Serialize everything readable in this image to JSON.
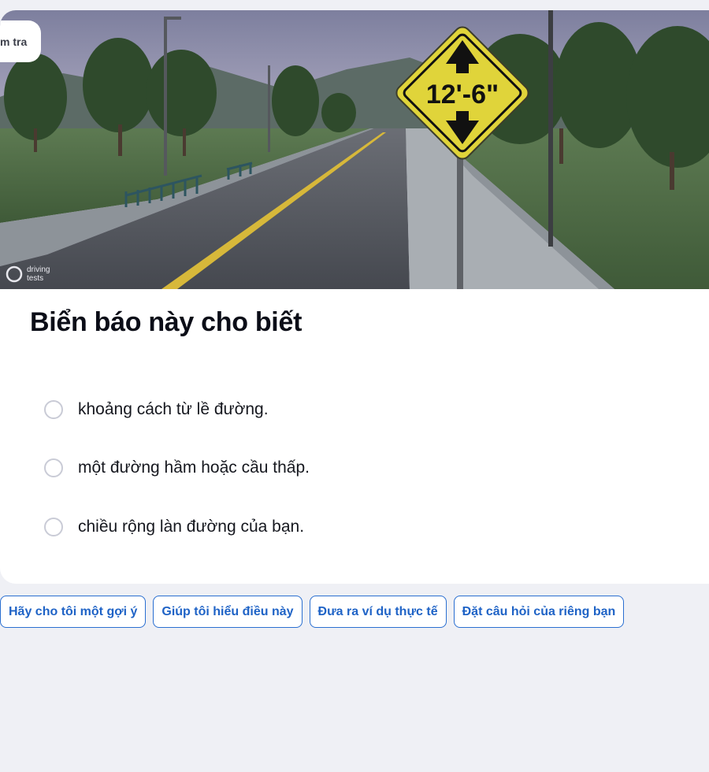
{
  "header": {
    "pill_label": "m tra"
  },
  "image": {
    "watermark_line1": "driving",
    "watermark_line2": "tests",
    "sign_text": "12'-6\""
  },
  "question": {
    "title": "Biển báo này cho biết",
    "options": [
      {
        "label": "khoảng cách từ lề đường."
      },
      {
        "label": "một đường hầm hoặc cầu thấp."
      },
      {
        "label": "chiều rộng làn đường của bạn."
      }
    ]
  },
  "suggestions": [
    {
      "label": "Hãy cho tôi một gợi ý"
    },
    {
      "label": "Giúp tôi hiểu điều này"
    },
    {
      "label": "Đưa ra ví dụ thực tế"
    },
    {
      "label": "Đặt câu hỏi của riêng bạn"
    }
  ],
  "colors": {
    "page_background": "#eff0f5",
    "accent": "#1f63c6",
    "sign_yellow": "#e0d43a"
  }
}
